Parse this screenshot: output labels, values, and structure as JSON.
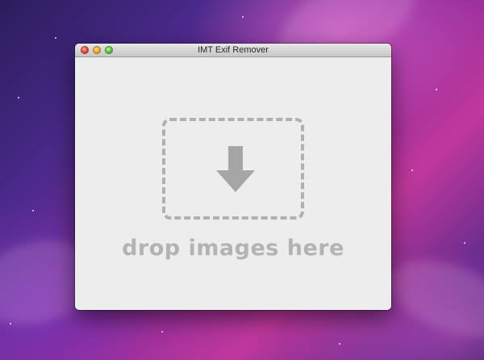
{
  "window": {
    "title": "IMT Exif Remover"
  },
  "dropzone": {
    "label": "drop images here",
    "icon": "arrow-down-icon"
  },
  "colors": {
    "window_bg": "#ededed",
    "dropzone_border": "#b0b0b0",
    "label_text": "#b3b3b3",
    "close_button": "#e0443b",
    "minimize_button": "#e6a521",
    "zoom_button": "#5fbd3a"
  }
}
